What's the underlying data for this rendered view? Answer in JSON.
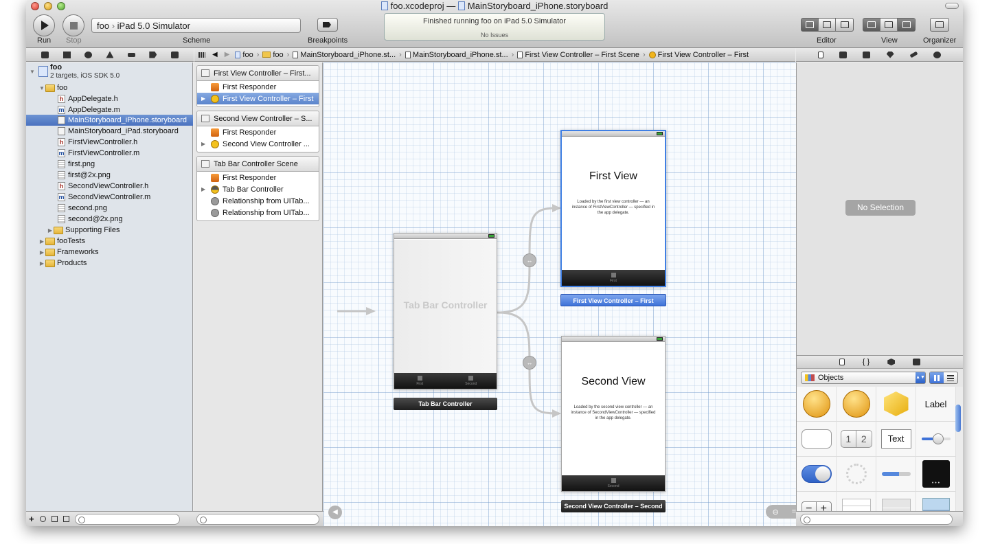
{
  "window": {
    "project_file": "foo.xcodeproj",
    "title_sep": "—",
    "storyboard_file": "MainStoryboard_iPhone.storyboard"
  },
  "toolbar": {
    "run_label": "Run",
    "stop_label": "Stop",
    "scheme_target": "foo",
    "scheme_sep": "›",
    "scheme_device": "iPad 5.0 Simulator",
    "scheme_label": "Scheme",
    "breakpoints_label": "Breakpoints",
    "activity_status": "Finished running foo on iPad 5.0 Simulator",
    "activity_issues": "No Issues",
    "editor_label": "Editor",
    "view_label": "View",
    "organizer_label": "Organizer"
  },
  "jumpbar": {
    "items": [
      "foo",
      "foo",
      "MainStoryboard_iPhone.st...",
      "MainStoryboard_iPhone.st...",
      "First View Controller – First Scene",
      "First View Controller – First"
    ],
    "separator": "›"
  },
  "navigator": {
    "project_name": "foo",
    "project_subtitle": "2 targets, iOS SDK 5.0",
    "items": [
      {
        "label": "foo",
        "type": "folder"
      },
      {
        "label": "AppDelegate.h",
        "type": "h"
      },
      {
        "label": "AppDelegate.m",
        "type": "m"
      },
      {
        "label": "MainStoryboard_iPhone.storyboard",
        "type": "storyboard"
      },
      {
        "label": "MainStoryboard_iPad.storyboard",
        "type": "storyboard"
      },
      {
        "label": "FirstViewController.h",
        "type": "h"
      },
      {
        "label": "FirstViewController.m",
        "type": "m"
      },
      {
        "label": "first.png",
        "type": "png"
      },
      {
        "label": "first@2x.png",
        "type": "png"
      },
      {
        "label": "SecondViewController.h",
        "type": "h"
      },
      {
        "label": "SecondViewController.m",
        "type": "m"
      },
      {
        "label": "second.png",
        "type": "png"
      },
      {
        "label": "second@2x.png",
        "type": "png"
      },
      {
        "label": "Supporting Files",
        "type": "folder"
      },
      {
        "label": "fooTests",
        "type": "folder"
      },
      {
        "label": "Frameworks",
        "type": "folder"
      },
      {
        "label": "Products",
        "type": "folder"
      }
    ]
  },
  "outline": {
    "scenes": [
      {
        "title": "First View Controller – First...",
        "rows": [
          "First Responder",
          "First View Controller – First"
        ]
      },
      {
        "title": "Second View Controller – S...",
        "rows": [
          "First Responder",
          "Second View Controller ..."
        ]
      },
      {
        "title": "Tab Bar Controller Scene",
        "rows": [
          "First Responder",
          "Tab Bar Controller",
          "Relationship from UITab...",
          "Relationship from UITab..."
        ]
      }
    ]
  },
  "canvas": {
    "tab_bar_controller_title": "Tab Bar Controller",
    "tab_bar_controller_label": "Tab Bar Controller",
    "tab_first": "First",
    "tab_second": "Second",
    "first_view_title": "First View",
    "first_view_desc": "Loaded by the first view controller — an instance of FirstViewController — specified in the app delegate.",
    "first_view_label": "First View Controller – First",
    "second_view_title": "Second View",
    "second_view_desc": "Loaded by the second view controller — an instance of SecondViewController — specified in the app delegate.",
    "second_view_label": "Second View Controller – Second",
    "segue_glyph": "↔"
  },
  "inspector": {
    "no_selection": "No Selection"
  },
  "library": {
    "filter_selected": "Objects",
    "items": [
      "Label",
      "Text"
    ],
    "segmented_1": "1",
    "segmented_2": "2",
    "stepper_minus": "−",
    "stepper_plus": "+"
  },
  "icons": {
    "accent_blue": "#3f7fe4",
    "selection_blue": "#4a72bf"
  }
}
